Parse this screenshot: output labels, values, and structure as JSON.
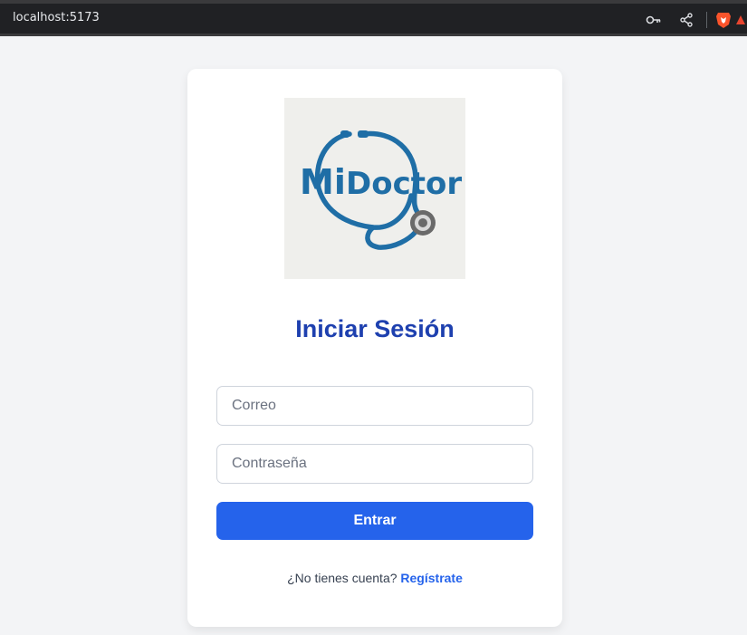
{
  "browser": {
    "url": "localhost:5173",
    "icons": [
      "key-icon",
      "share-icon",
      "brave-lion-icon",
      "rewards-triangle-icon"
    ]
  },
  "logo": {
    "text_mi": "Mi",
    "text_doctor": "Doctor",
    "brand_color": "#1f6ea6",
    "background": "#efefec"
  },
  "login": {
    "title": "Iniciar Sesión",
    "email_placeholder": "Correo",
    "password_placeholder": "Contraseña",
    "submit_label": "Entrar",
    "no_account_text": "¿No tienes cuenta?",
    "register_link": "Regístrate"
  },
  "colors": {
    "title": "#1e40af",
    "button": "#2563eb",
    "link": "#2563eb",
    "page_bg": "#f3f4f6"
  }
}
